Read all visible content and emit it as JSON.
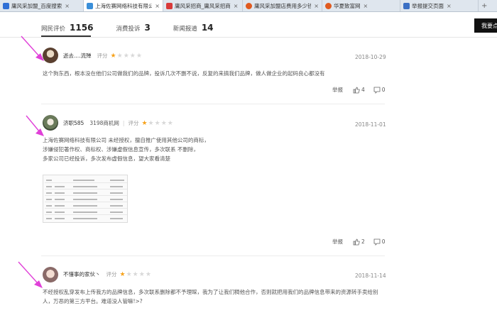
{
  "browser_tabs": [
    {
      "label": "庸风采加盟_百度搜索",
      "active": false,
      "fav_color": "#2f6fd6"
    },
    {
      "label": "上海佐赛网络科技有限公",
      "active": true,
      "fav_color": "#3a8fd9"
    },
    {
      "label": "庸风采招商_庸风采招商",
      "active": false,
      "fav_color": "#d83a3a"
    },
    {
      "label": "庸风采加盟店费用多少钱",
      "active": false,
      "fav_color": "#e05a1f"
    },
    {
      "label": "华夏致富网",
      "active": false,
      "fav_color": "#e05a1f"
    },
    {
      "label": "举报提交页面",
      "active": false,
      "fav_color": "#3b6fc4"
    }
  ],
  "nav": {
    "tabs": [
      {
        "label": "网民评价",
        "count": "1156"
      },
      {
        "label": "消费投诉",
        "count": "3"
      },
      {
        "label": "新闻报道",
        "count": "14"
      }
    ],
    "right_button": "我要点"
  },
  "reviews": [
    {
      "user": "逝去....流殚",
      "source": "",
      "rating_label": "评分",
      "rating": 1,
      "date": "2018-10-29",
      "lines": [
        "这个狗东西，根本没在他们公司做我们的品牌，投诉几次不删不说，反复的来搞我们品牌，做人做企业的起码良心都没有"
      ],
      "report": "举报",
      "likes": "4",
      "comments": "0"
    },
    {
      "user": "济职585",
      "source": "3198商机网",
      "rating_label": "评分",
      "rating": 1,
      "date": "2018-11-01",
      "lines": [
        "上海佐赛网络科技有限公司 未经授权，擅自推广使用其他公司的商标，",
        "涉嫌侵犯著作权、商标权、涉嫌虚假信息宣传，多次联系 不删除，",
        "多家公司已经投诉，多次发布虚假信息，望大家看清楚"
      ],
      "report": "举报",
      "likes": "2",
      "comments": "0"
    },
    {
      "user": "不懂事的家伙丶",
      "source": "",
      "rating_label": "评分",
      "rating": 1,
      "date": "2018-11-14",
      "lines": [
        "不经授权乱穿发布上传我方的品牌信息，多次联系删除都不予理睬，我为了让我们稠他合作，否则就把用我们的品牌信息带来的资源转手卖给别",
        "人，万恶的第三方平台。难道没人管嘛!>?"
      ],
      "report": "",
      "likes": "",
      "comments": ""
    }
  ],
  "colors": {
    "arrow": "#e040d8",
    "star_on": "#f7a21b",
    "star_off": "#d8d8d8"
  }
}
